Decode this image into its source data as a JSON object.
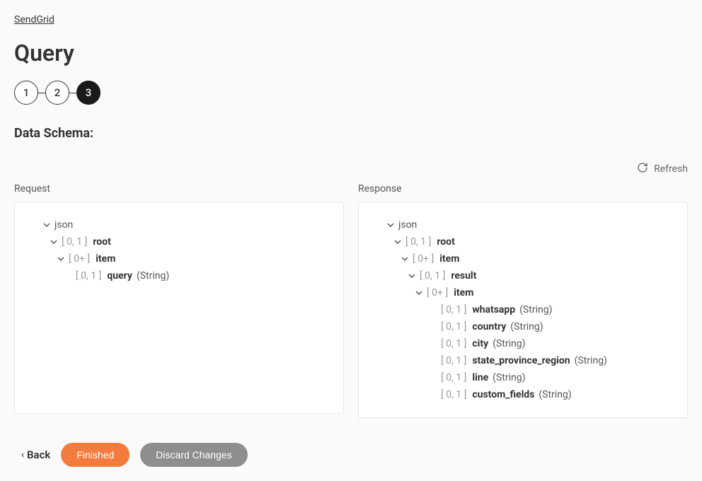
{
  "breadcrumb": "SendGrid",
  "page_title": "Query",
  "stepper": [
    "1",
    "2",
    "3"
  ],
  "active_step_index": 2,
  "section_title": "Data Schema:",
  "refresh_label": "Refresh",
  "request": {
    "label": "Request",
    "root_format": "json",
    "nodes": [
      {
        "indent": 1,
        "chev": true,
        "card": "[ 0, 1 ]",
        "name": "root",
        "type": ""
      },
      {
        "indent": 2,
        "chev": true,
        "card": "[ 0+ ]",
        "name": "item",
        "type": ""
      },
      {
        "indent": 3,
        "chev": false,
        "card": "[ 0, 1 ]",
        "name": "query",
        "type": "(String)"
      }
    ]
  },
  "response": {
    "label": "Response",
    "root_format": "json",
    "nodes": [
      {
        "indent": 1,
        "chev": true,
        "card": "[ 0, 1 ]",
        "name": "root",
        "type": ""
      },
      {
        "indent": 2,
        "chev": true,
        "card": "[ 0+ ]",
        "name": "item",
        "type": ""
      },
      {
        "indent": 3,
        "chev": true,
        "card": "[ 0, 1 ]",
        "name": "result",
        "type": ""
      },
      {
        "indent": 4,
        "chev": true,
        "card": "[ 0+ ]",
        "name": "item",
        "type": ""
      },
      {
        "indent": 5,
        "chev": false,
        "card": "[ 0, 1 ]",
        "name": "whatsapp",
        "type": "(String)"
      },
      {
        "indent": 5,
        "chev": false,
        "card": "[ 0, 1 ]",
        "name": "country",
        "type": "(String)"
      },
      {
        "indent": 5,
        "chev": false,
        "card": "[ 0, 1 ]",
        "name": "city",
        "type": "(String)"
      },
      {
        "indent": 5,
        "chev": false,
        "card": "[ 0, 1 ]",
        "name": "state_province_region",
        "type": "(String)"
      },
      {
        "indent": 5,
        "chev": false,
        "card": "[ 0, 1 ]",
        "name": "line",
        "type": "(String)"
      },
      {
        "indent": 5,
        "chev": false,
        "card": "[ 0, 1 ]",
        "name": "custom_fields",
        "type": "(String)"
      }
    ]
  },
  "footer": {
    "back": "Back",
    "finished": "Finished",
    "discard": "Discard Changes"
  }
}
